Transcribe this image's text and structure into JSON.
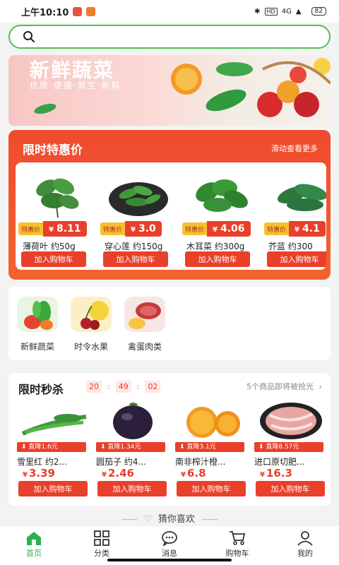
{
  "status_bar": {
    "time": "上午10:10",
    "network": "4G",
    "battery": "82"
  },
  "search": {
    "placeholder": ""
  },
  "banner": {
    "title": "新鲜蔬菜",
    "subtitle": "优质·便捷·原生·新鲜"
  },
  "special": {
    "title": "限时特惠价",
    "more": "滑动查看更多",
    "items": [
      {
        "tag": "特惠价",
        "price": "8.11",
        "name": "薄荷叶 约50g",
        "button": "加入购物车"
      },
      {
        "tag": "特惠价",
        "price": "3.0",
        "name": "穿心莲 约150g",
        "button": "加入购物车"
      },
      {
        "tag": "特惠价",
        "price": "4.06",
        "name": "木耳菜 约300g",
        "button": "加入购物车"
      },
      {
        "tag": "特惠价",
        "price": "4.1",
        "name": "芥蓝 约300",
        "button": "加入购物车"
      }
    ]
  },
  "categories": [
    {
      "label": "新鲜蔬菜",
      "icon": "vegetables-icon"
    },
    {
      "label": "时令水果",
      "icon": "fruit-icon"
    },
    {
      "label": "禽蛋肉类",
      "icon": "meat-icon"
    }
  ],
  "flash_sale": {
    "title": "限时秒杀",
    "timer": {
      "h": "20",
      "m": "49",
      "s": "02"
    },
    "note": "5个商品即将被抢光",
    "items": [
      {
        "drop": "直降1.6元",
        "name": "雪里红 约2...",
        "price": "3.39",
        "button": "加入购物车"
      },
      {
        "drop": "直降1.34元",
        "name": "圆茄子 约4...",
        "price": "2.46",
        "button": "加入购物车"
      },
      {
        "drop": "直降3.1元",
        "name": "南非榨汁橙...",
        "price": "6.8",
        "button": "加入购物车"
      },
      {
        "drop": "直降8.57元",
        "name": "进口原切肥...",
        "price": "16.3",
        "button": "加入购物车"
      }
    ]
  },
  "guess": "猜你喜欢",
  "currency": "¥",
  "tabs": [
    {
      "label": "首页",
      "icon": "home-icon",
      "active": true
    },
    {
      "label": "分类",
      "icon": "category-icon",
      "active": false
    },
    {
      "label": "消息",
      "icon": "message-icon",
      "active": false
    },
    {
      "label": "购物车",
      "icon": "cart-icon",
      "active": false
    },
    {
      "label": "我的",
      "icon": "user-icon",
      "active": false
    }
  ],
  "colors": {
    "accent": "#e8402a",
    "brand_green": "#2bb24c",
    "tag_yellow": "#f6c12f"
  }
}
